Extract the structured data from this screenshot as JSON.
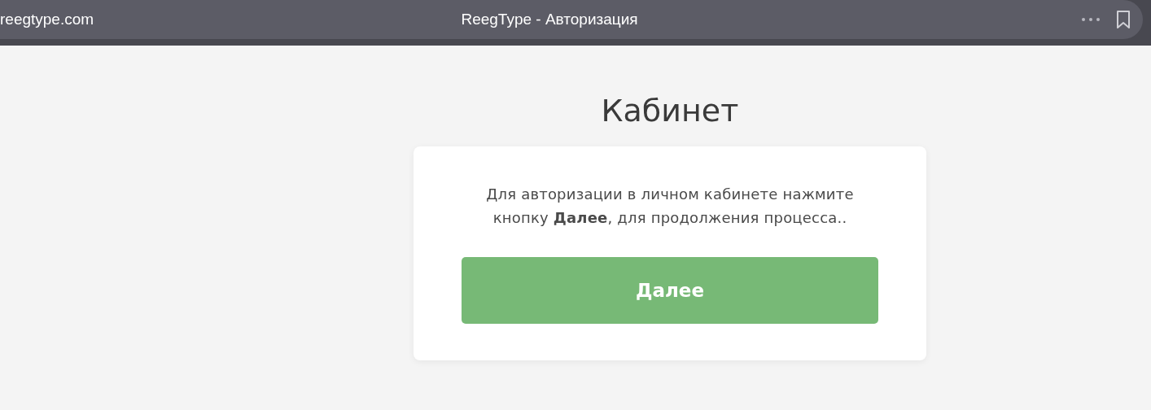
{
  "browser": {
    "address": "reegtype.com",
    "title": "ReegType - Авторизация"
  },
  "page": {
    "heading": "Кабинет",
    "message": "Для авторизации в личном кабинете нажмите кнопку **Далее**, для продолжения процесса..",
    "button": "Далее"
  }
}
